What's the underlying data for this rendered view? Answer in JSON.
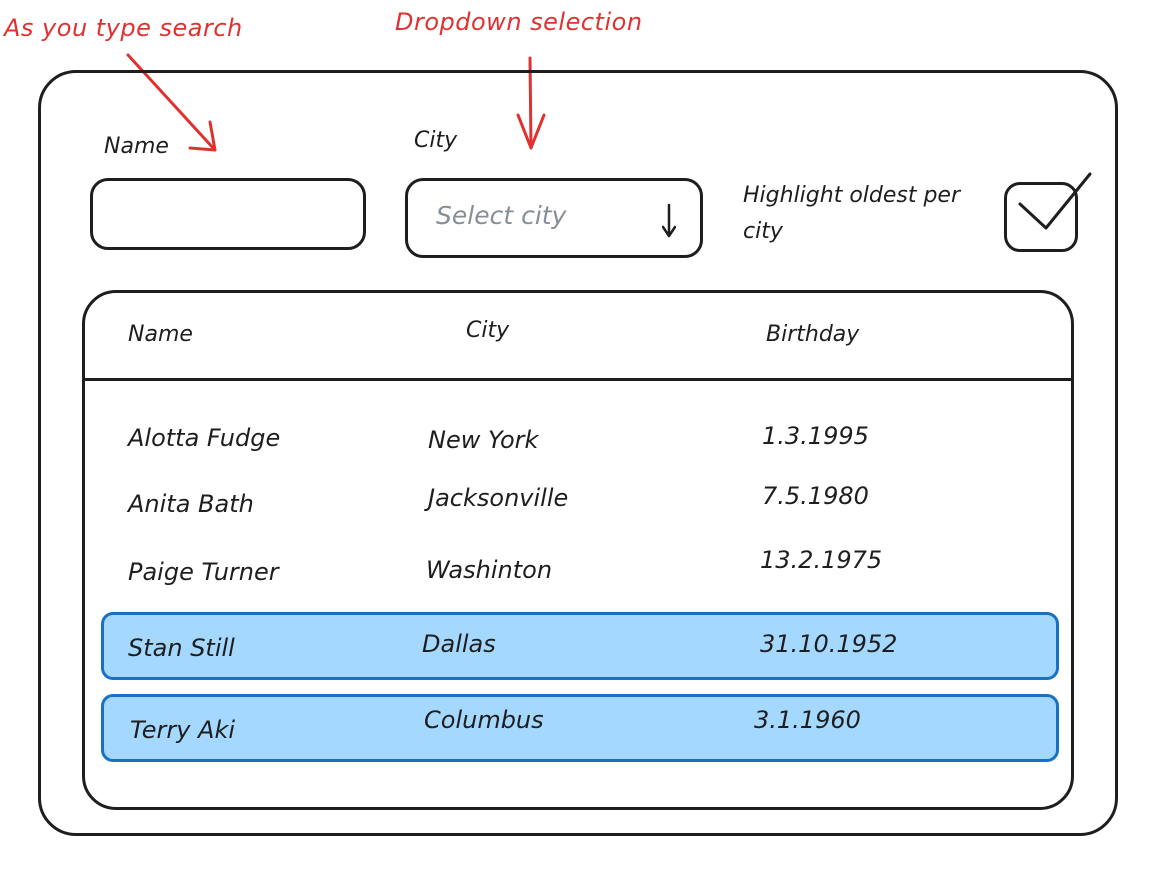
{
  "annotations": {
    "search": "As you type search",
    "dropdown": "Dropdown selection"
  },
  "filters": {
    "name_label": "Name",
    "name_value": "",
    "city_label": "City",
    "city_placeholder": "Select city",
    "highlight_label": "Highlight oldest per city",
    "highlight_checked": true
  },
  "table": {
    "columns": [
      "Name",
      "City",
      "Birthday"
    ],
    "rows": [
      {
        "name": "Alotta Fudge",
        "city": "New York",
        "birthday": "1.3.1995",
        "highlighted": false
      },
      {
        "name": "Anita Bath",
        "city": "Jacksonville",
        "birthday": "7.5.1980",
        "highlighted": false
      },
      {
        "name": "Paige Turner",
        "city": "Washinton",
        "birthday": "13.2.1975",
        "highlighted": false
      },
      {
        "name": "Stan Still",
        "city": "Dallas",
        "birthday": "31.10.1952",
        "highlighted": true
      },
      {
        "name": "Terry Aki",
        "city": "Columbus",
        "birthday": "3.1.1960",
        "highlighted": true
      }
    ]
  },
  "colors": {
    "annotation": "#e03131",
    "highlight_fill": "#a5d8ff",
    "highlight_stroke": "#1971c2",
    "ink": "#1e1e1e",
    "placeholder": "#868e96"
  }
}
